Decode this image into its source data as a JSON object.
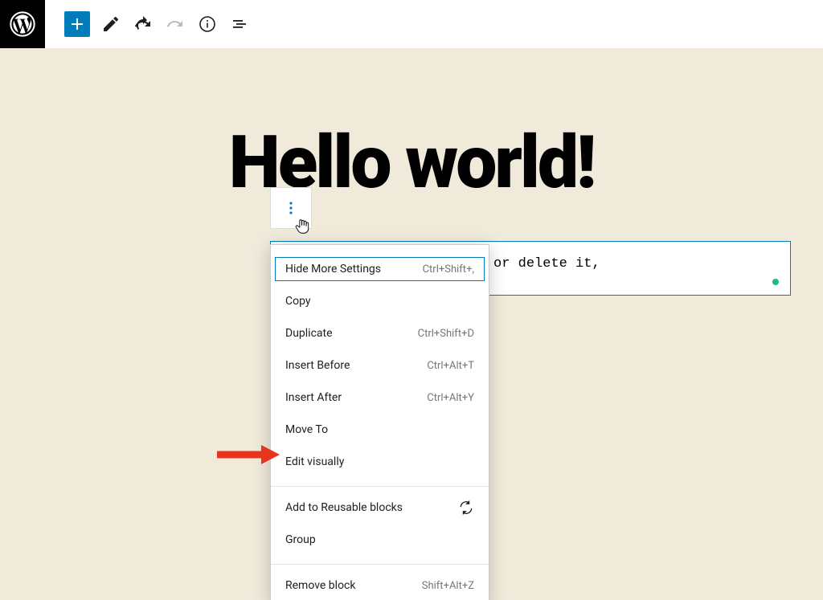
{
  "title": "Hello world!",
  "paragraph": "is your first post. Edit or delete it,",
  "menu": {
    "section1": [
      {
        "label": "Hide More Settings",
        "shortcut": "Ctrl+Shift+,",
        "highlighted": true
      },
      {
        "label": "Copy",
        "shortcut": ""
      },
      {
        "label": "Duplicate",
        "shortcut": "Ctrl+Shift+D"
      },
      {
        "label": "Insert Before",
        "shortcut": "Ctrl+Alt+T"
      },
      {
        "label": "Insert After",
        "shortcut": "Ctrl+Alt+Y"
      },
      {
        "label": "Move To",
        "shortcut": ""
      },
      {
        "label": "Edit visually",
        "shortcut": ""
      }
    ],
    "section2": [
      {
        "label": "Add to Reusable blocks",
        "icon": "refresh"
      },
      {
        "label": "Group",
        "shortcut": ""
      }
    ],
    "section3": [
      {
        "label": "Remove block",
        "shortcut": "Shift+Alt+Z"
      }
    ]
  },
  "toolbar": {
    "add": "Add block",
    "edit": "Tools",
    "undo": "Undo",
    "redo": "Redo",
    "info": "Details",
    "outline": "Outline"
  }
}
